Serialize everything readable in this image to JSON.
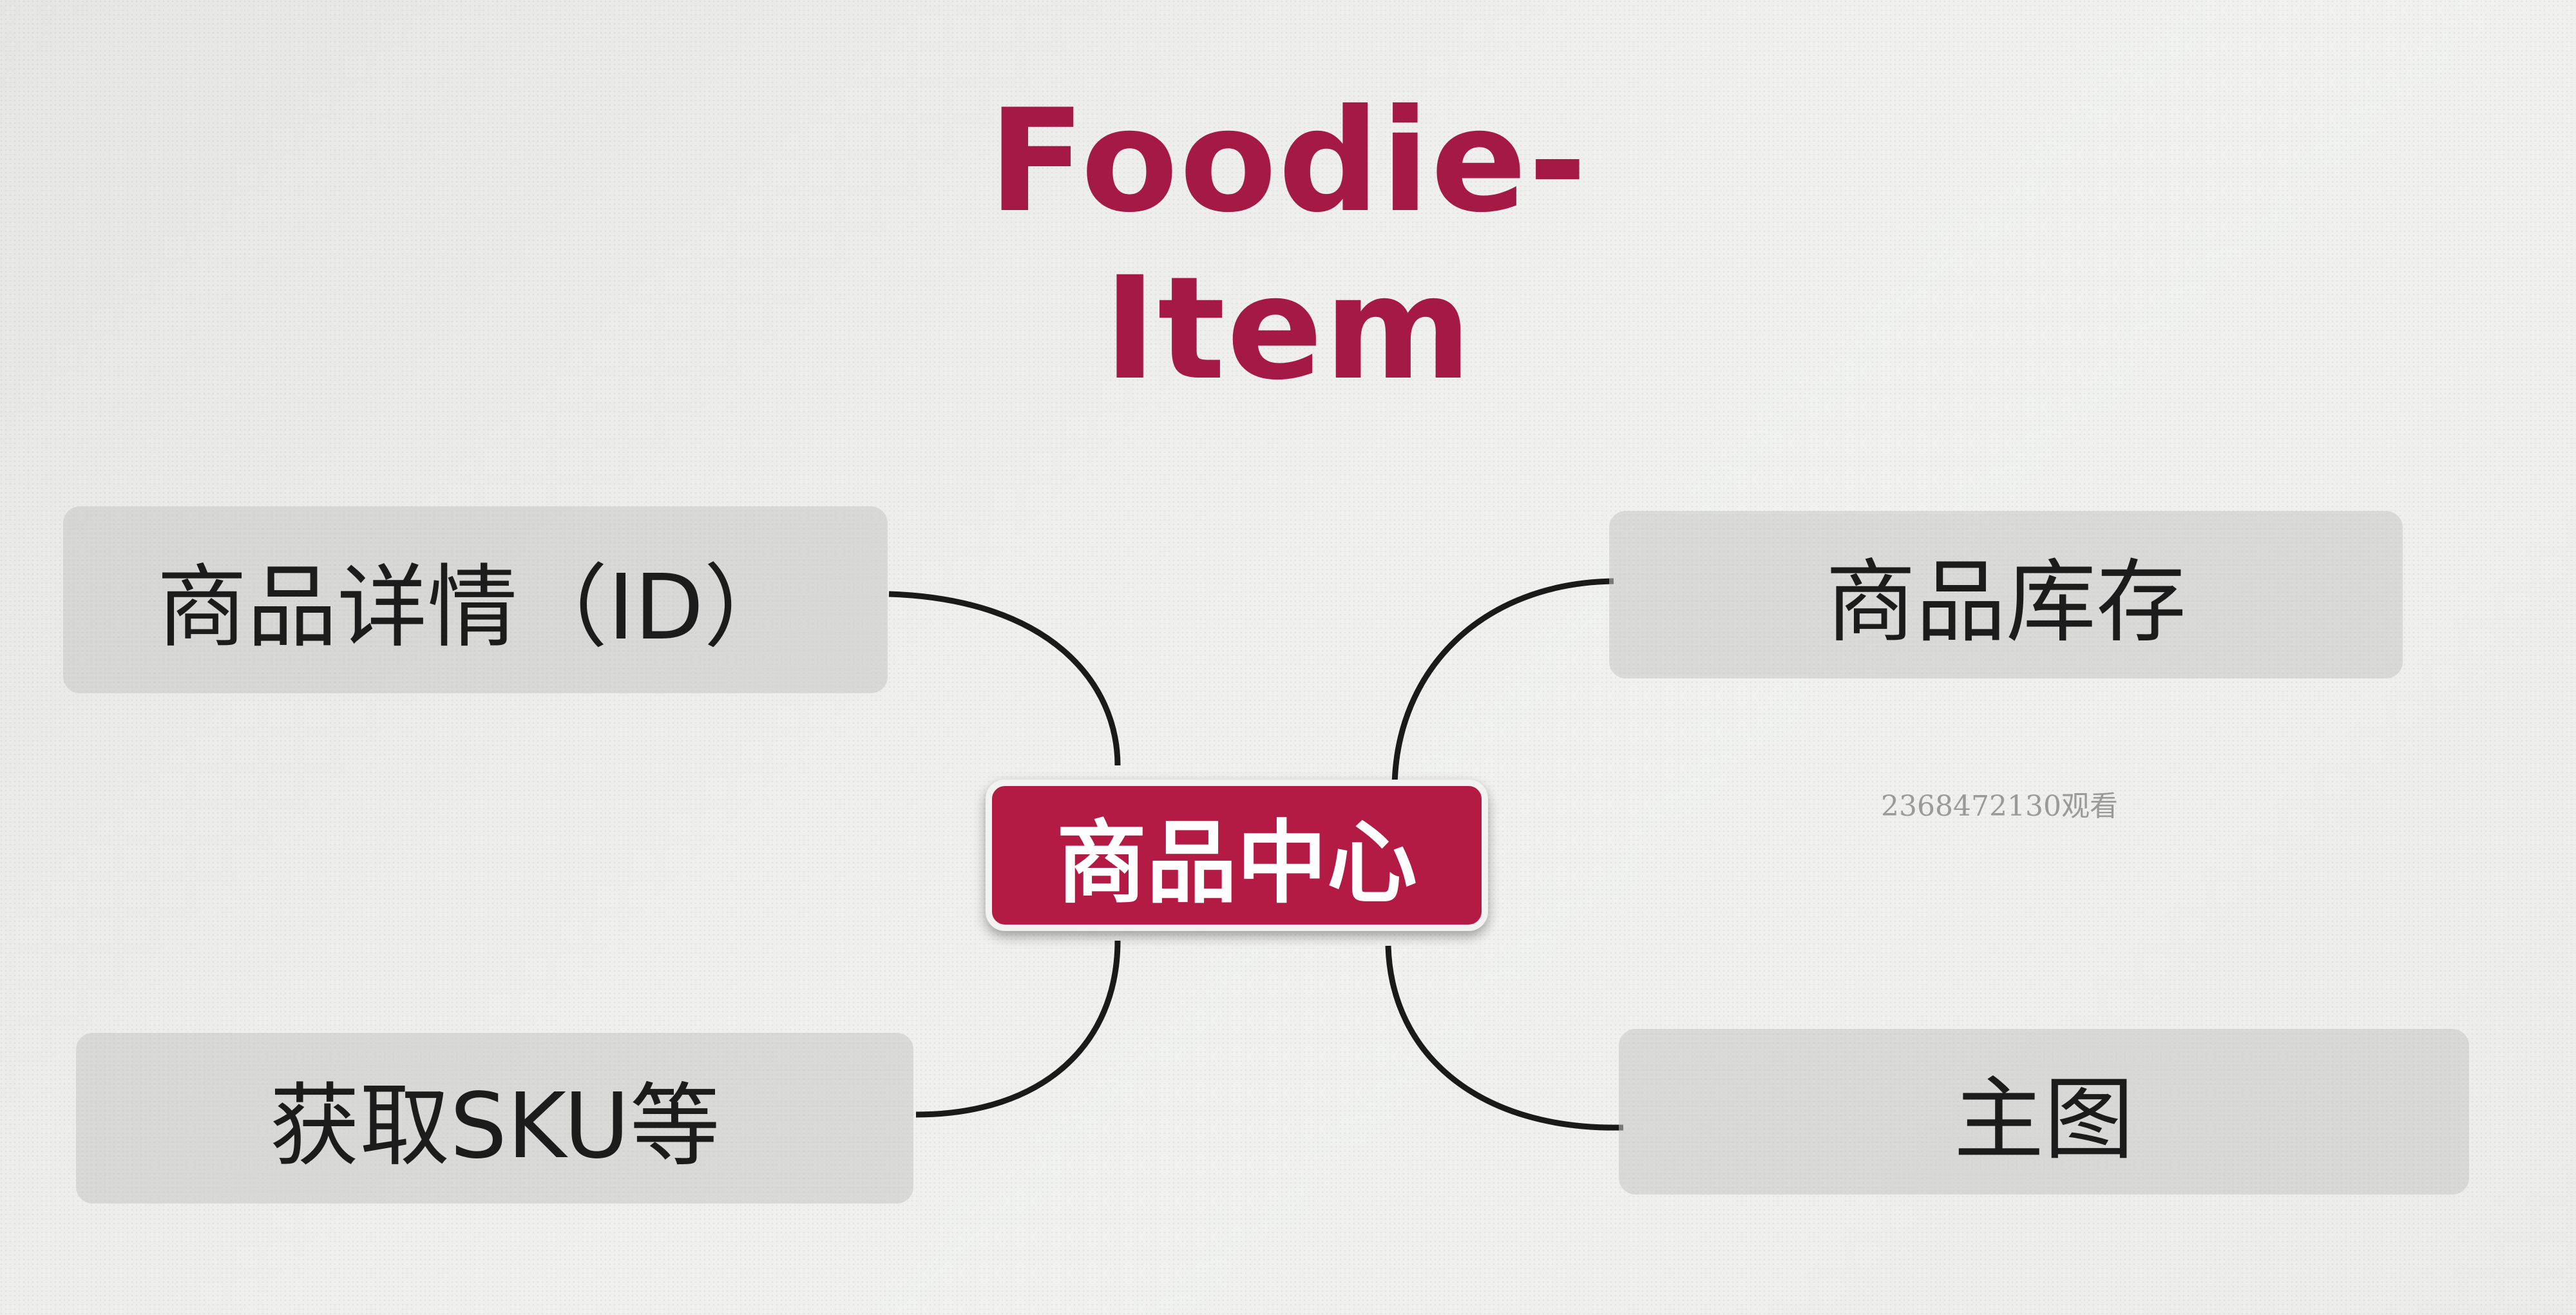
{
  "title": "Foodie-Item",
  "center_node": {
    "label": "商品中心"
  },
  "branches": {
    "top_left": {
      "label": "商品详情（ID）"
    },
    "bottom_left": {
      "label": "获取SKU等"
    },
    "top_right": {
      "label": "商品库存"
    },
    "bottom_right": {
      "label": "主图"
    }
  },
  "watermark": "2368472130观看",
  "colors": {
    "accent": "#a51a45",
    "center_fill": "#b31a44",
    "node_fill": "#c6c6c4",
    "connector": "#1a1a1a"
  }
}
